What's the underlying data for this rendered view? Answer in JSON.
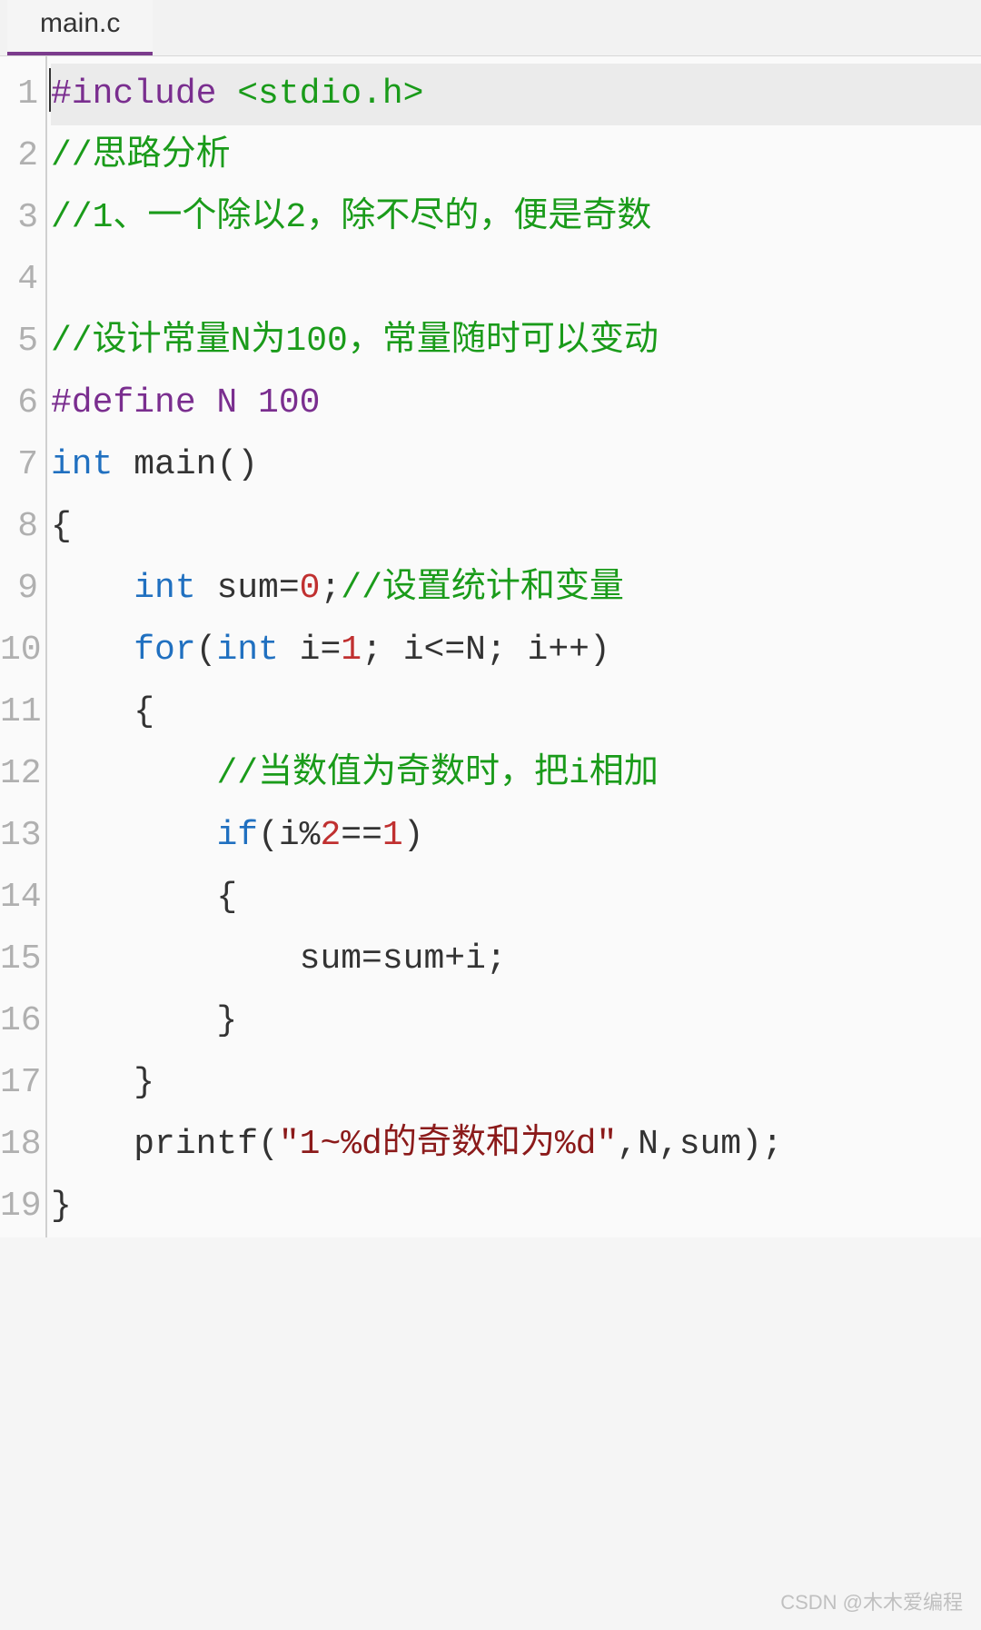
{
  "tab": {
    "filename": "main.c"
  },
  "lines": [
    {
      "num": "1",
      "tokens": [
        {
          "c": "pp",
          "t": "#include"
        },
        {
          "c": "txt",
          "t": " "
        },
        {
          "c": "cm",
          "t": "<stdio.h>"
        }
      ]
    },
    {
      "num": "2",
      "tokens": [
        {
          "c": "cm",
          "t": "//思路分析"
        }
      ]
    },
    {
      "num": "3",
      "tokens": [
        {
          "c": "cm",
          "t": "//1、一个除以2，除不尽的，便是奇数"
        }
      ]
    },
    {
      "num": "4",
      "tokens": []
    },
    {
      "num": "5",
      "tokens": [
        {
          "c": "cm",
          "t": "//设计常量N为100，常量随时可以变动"
        }
      ]
    },
    {
      "num": "6",
      "tokens": [
        {
          "c": "pp",
          "t": "#define N 100"
        }
      ]
    },
    {
      "num": "7",
      "tokens": [
        {
          "c": "kw",
          "t": "int"
        },
        {
          "c": "txt",
          "t": " main()"
        }
      ]
    },
    {
      "num": "8",
      "tokens": [
        {
          "c": "txt",
          "t": "{"
        }
      ]
    },
    {
      "num": "9",
      "tokens": [
        {
          "c": "txt",
          "t": "    "
        },
        {
          "c": "kw",
          "t": "int"
        },
        {
          "c": "txt",
          "t": " sum="
        },
        {
          "c": "num",
          "t": "0"
        },
        {
          "c": "txt",
          "t": ";"
        },
        {
          "c": "cm",
          "t": "//设置统计和变量"
        }
      ]
    },
    {
      "num": "10",
      "tokens": [
        {
          "c": "txt",
          "t": "    "
        },
        {
          "c": "kw",
          "t": "for"
        },
        {
          "c": "txt",
          "t": "("
        },
        {
          "c": "kw",
          "t": "int"
        },
        {
          "c": "txt",
          "t": " i="
        },
        {
          "c": "num",
          "t": "1"
        },
        {
          "c": "txt",
          "t": "; i<=N; i++)"
        }
      ]
    },
    {
      "num": "11",
      "tokens": [
        {
          "c": "txt",
          "t": "    {"
        }
      ]
    },
    {
      "num": "12",
      "tokens": [
        {
          "c": "txt",
          "t": "        "
        },
        {
          "c": "cm",
          "t": "//当数值为奇数时，把i相加"
        }
      ]
    },
    {
      "num": "13",
      "tokens": [
        {
          "c": "txt",
          "t": "        "
        },
        {
          "c": "kw",
          "t": "if"
        },
        {
          "c": "txt",
          "t": "(i%"
        },
        {
          "c": "num",
          "t": "2"
        },
        {
          "c": "txt",
          "t": "=="
        },
        {
          "c": "num",
          "t": "1"
        },
        {
          "c": "txt",
          "t": ")"
        }
      ]
    },
    {
      "num": "14",
      "tokens": [
        {
          "c": "txt",
          "t": "        {"
        }
      ]
    },
    {
      "num": "15",
      "tokens": [
        {
          "c": "txt",
          "t": "            sum=sum+i;"
        }
      ]
    },
    {
      "num": "16",
      "tokens": [
        {
          "c": "txt",
          "t": "        }"
        }
      ]
    },
    {
      "num": "17",
      "tokens": [
        {
          "c": "txt",
          "t": "    }"
        }
      ]
    },
    {
      "num": "18",
      "tokens": [
        {
          "c": "txt",
          "t": "    printf("
        },
        {
          "c": "str",
          "t": "\"1~%d的奇数和为%d\""
        },
        {
          "c": "txt",
          "t": ",N,sum);"
        }
      ]
    },
    {
      "num": "19",
      "tokens": [
        {
          "c": "txt",
          "t": "}"
        }
      ]
    }
  ],
  "watermark": "CSDN @木木爱编程"
}
